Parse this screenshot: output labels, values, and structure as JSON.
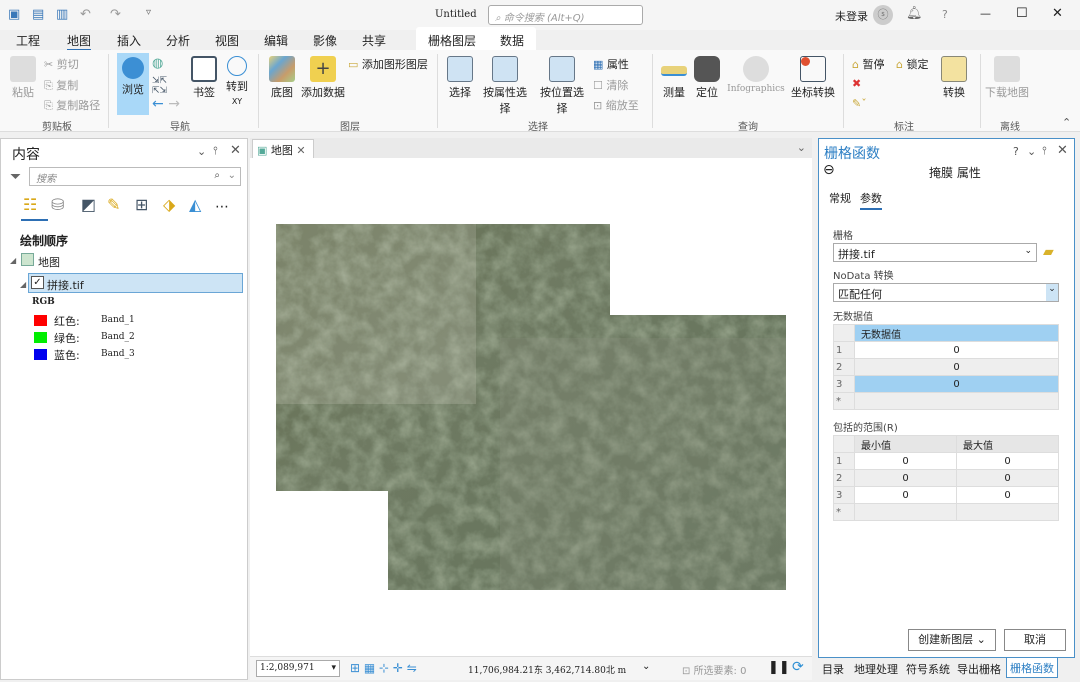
{
  "title": {
    "doc": "Untitled",
    "search_placeholder": "命令搜索 (Alt+Q)",
    "login": "未登录",
    "help": "?",
    "min": "—",
    "max": "☐",
    "close": "✕"
  },
  "tabs": [
    "工程",
    "地图",
    "插入",
    "分析",
    "视图",
    "编辑",
    "影像",
    "共享",
    "栅格图层",
    "数据"
  ],
  "ribbon": {
    "clipboard": {
      "paste": "粘贴",
      "cut": "剪切",
      "copy": "复制",
      "copy_path": "复制路径",
      "group": "剪贴板"
    },
    "nav": {
      "explore": "浏览",
      "bookmarks": "书签",
      "goto": "转到",
      "goto_sub": "XY",
      "group": "导航"
    },
    "layer": {
      "basemap": "底图",
      "add_data": "添加数据",
      "add_graphics": "添加图形图层",
      "group": "图层"
    },
    "selection": {
      "select": "选择",
      "by_attr": "按属性选择",
      "by_loc": "按位置选择",
      "attributes": "属性",
      "clear": "清除",
      "zoom_to": "缩放至",
      "group": "选择"
    },
    "inquiry": {
      "measure": "测量",
      "locate": "定位",
      "infographics": "Infographics",
      "coord": "坐标转换",
      "group": "查询"
    },
    "labeling": {
      "pause": "暂停",
      "lock": "锁定",
      "convert": "转换",
      "group": "标注"
    },
    "offline": {
      "download": "下载地图",
      "group": "离线"
    }
  },
  "contents": {
    "title": "内容",
    "search_placeholder": "搜索",
    "draw_order": "绘制顺序",
    "map": "地图",
    "layer": "拼接.tif",
    "rgb": "RGB",
    "bands": [
      {
        "label": "红色:",
        "band": "Band_1",
        "color": "#ff0000"
      },
      {
        "label": "绿色:",
        "band": "Band_2",
        "color": "#00ee00"
      },
      {
        "label": "蓝色:",
        "band": "Band_3",
        "color": "#0000ee"
      }
    ]
  },
  "map_tab": "地图",
  "status": {
    "scale": "1:2,089,971",
    "coords": "11,706,984.21东 3,462,714.80北 m",
    "selected": "所选要素: 0"
  },
  "raster_fn": {
    "title": "栅格函数",
    "subtitle": "掩膜 属性",
    "tab_general": "常规",
    "tab_params": "参数",
    "raster_label": "栅格",
    "raster_value": "拼接.tif",
    "nodata_label": "NoData 转换",
    "nodata_value": "匹配任何",
    "nodata_section": "无数据值",
    "nodata_header": "无数据值",
    "nodata_rows": [
      {
        "n": "1",
        "v": "0"
      },
      {
        "n": "2",
        "v": "0"
      },
      {
        "n": "3",
        "v": "0"
      }
    ],
    "range_label": "包括的范围(R)",
    "range_headers": [
      "最小值",
      "最大值"
    ],
    "range_rows": [
      {
        "n": "1",
        "min": "0",
        "max": "0"
      },
      {
        "n": "2",
        "min": "0",
        "max": "0"
      },
      {
        "n": "3",
        "min": "0",
        "max": "0"
      }
    ],
    "new_row": "*",
    "create": "创建新图层",
    "cancel": "取消"
  },
  "bottom_tabs": [
    "目录",
    "地理处理",
    "符号系统",
    "导出栅格",
    "栅格函数"
  ],
  "colors": {
    "accent": "#2d6fb4",
    "selection": "#9fd0f2"
  }
}
